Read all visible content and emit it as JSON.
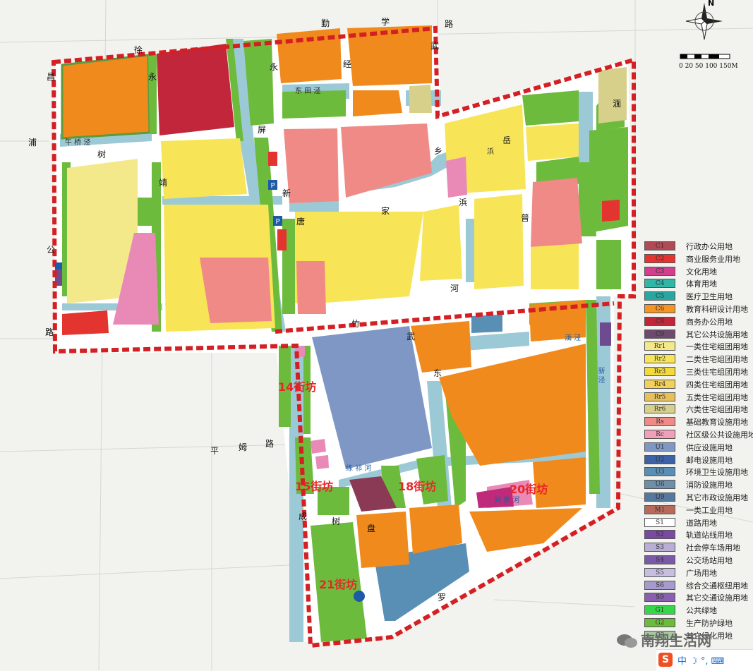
{
  "map": {
    "districts": [
      {
        "id": "d14",
        "text": "14街坊"
      },
      {
        "id": "d15",
        "text": "15街坊"
      },
      {
        "id": "d18",
        "text": "18街坊"
      },
      {
        "id": "d20",
        "text": "20街坊"
      },
      {
        "id": "d21",
        "text": "21街坊"
      }
    ],
    "roads": {
      "r_top1": "勤",
      "r_top2": "学",
      "r_top3": "路",
      "r_chang": "昌",
      "r_xu": "徐",
      "r_shu": "树",
      "r_pu": "浦",
      "r_gong": "公",
      "r_lu_left": "路",
      "r_yong1": "永",
      "r_yong2": "永",
      "r_jing": "靖",
      "r_ping": "屏",
      "r_xin": "新",
      "r_tang": "唐",
      "r_jia": "家",
      "r_bang": "浜",
      "r_zhu": "竹",
      "r_wu": "武",
      "r_dong": "东",
      "r_mian": "湎",
      "r_pingmu": "平",
      "r_pingmu2": "姆",
      "r_pingmu3": "路",
      "r_cheng": "成",
      "r_shu2": "树",
      "r_pan": "盘",
      "r_luo": "罗",
      "r_xiang": "乡",
      "r_yue": "岳",
      "r_pu2": "普",
      "r_he": "河",
      "r_wuxing": "武",
      "r_jing2": "经"
    },
    "water_labels": {
      "w1": "东 田 泾",
      "w2": "午 桥 泾",
      "w3": "浜",
      "w4": "湎 泾",
      "w5": "新 泾",
      "w6": "练 祁 河",
      "w7": "刘 家 河"
    }
  },
  "scale": {
    "text": "0 20 50  100  150M"
  },
  "north": {
    "text": "N"
  },
  "legend": [
    {
      "code": "C1",
      "label": "行政办公用地",
      "color": "#b04a55"
    },
    {
      "code": "C2",
      "label": "商业服务业用地",
      "color": "#e3342f"
    },
    {
      "code": "C3",
      "label": "文化用地",
      "color": "#d43e8f"
    },
    {
      "code": "C4",
      "label": "体育用地",
      "color": "#2fb7a8"
    },
    {
      "code": "C5",
      "label": "医疗卫生用地",
      "color": "#2aa6a0"
    },
    {
      "code": "C6",
      "label": "教育科研设计用地",
      "color": "#f39424"
    },
    {
      "code": "C8",
      "label": "商务办公用地",
      "color": "#c2263b"
    },
    {
      "code": "C9",
      "label": "其它公共设施用地",
      "color": "#6e4a6e"
    },
    {
      "code": "Rr1",
      "label": "一类住宅组团用地",
      "color": "#f3e98a"
    },
    {
      "code": "Rr2",
      "label": "二类住宅组团用地",
      "color": "#f7e557"
    },
    {
      "code": "Rr3",
      "label": "三类住宅组团用地",
      "color": "#f3d93a"
    },
    {
      "code": "Rr4",
      "label": "四类住宅组团用地",
      "color": "#f2d05a"
    },
    {
      "code": "Rr5",
      "label": "五类住宅组团用地",
      "color": "#e8c05a"
    },
    {
      "code": "Rr6",
      "label": "六类住宅组团用地",
      "color": "#d6d08a"
    },
    {
      "code": "Rs",
      "label": "基础教育设施用地",
      "color": "#f08a86"
    },
    {
      "code": "Rc",
      "label": "社区级公共设施用地",
      "color": "#f1a0b9"
    },
    {
      "code": "U1",
      "label": "供应设施用地",
      "color": "#7f97c4"
    },
    {
      "code": "U2",
      "label": "邮电设施用地",
      "color": "#3d63a6"
    },
    {
      "code": "U3",
      "label": "环境卫生设施用地",
      "color": "#5a8fb5"
    },
    {
      "code": "U6",
      "label": "消防设施用地",
      "color": "#6f8fa8"
    },
    {
      "code": "U9",
      "label": "其它市政设施用地",
      "color": "#5577a0"
    },
    {
      "code": "M1",
      "label": "一类工业用地",
      "color": "#b86a5a"
    },
    {
      "code": "S1",
      "label": "道路用地",
      "color": "#ffffff"
    },
    {
      "code": "S2",
      "label": "轨道站线用地",
      "color": "#7a4aa0"
    },
    {
      "code": "S3",
      "label": "社会停车场用地",
      "color": "#b9aed6"
    },
    {
      "code": "S4",
      "label": "公交场站用地",
      "color": "#7a5aa6"
    },
    {
      "code": "S5",
      "label": "广场用地",
      "color": "#c7bfe0"
    },
    {
      "code": "S6",
      "label": "综合交通枢纽用地",
      "color": "#a79acc"
    },
    {
      "code": "S9",
      "label": "其它交通设施用地",
      "color": "#8a5fb0"
    },
    {
      "code": "G1",
      "label": "公共绿地",
      "color": "#35d64a"
    },
    {
      "code": "G2",
      "label": "生产防护绿地",
      "color": "#6dbb3c"
    },
    {
      "code": "G3",
      "label": "其它绿化用地",
      "color": "#a8c8a0"
    }
  ],
  "watermark": {
    "text": "南翔生活网"
  },
  "ime": {
    "text": "中 ☽ °, ⌨"
  }
}
